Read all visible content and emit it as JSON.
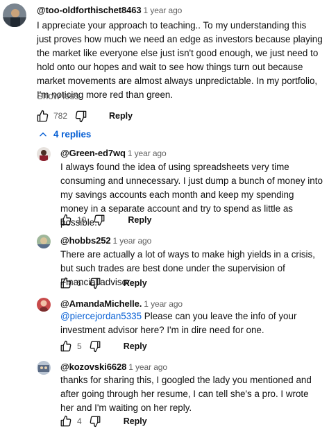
{
  "comments": [
    {
      "author": "@too-oldforthischet8463",
      "time": "1 year ago",
      "text": "I appreciate your approach to teaching.. To my understanding this just proves how much we need an edge as investors because playing the market like everyone else just isn't good enough, we just need to hold onto our hopes and wait to see how things turn out because market movements are almost always unpredictable. In my portfolio, I'm noticing more red than green.",
      "show_less": "Show less",
      "likes": "782",
      "reply_label": "Reply",
      "replies_toggle": "4 replies"
    }
  ],
  "replies": [
    {
      "author": "@Green-ed7wq",
      "time": "1 year ago",
      "text": "I always found the idea of using spreadsheets very time consuming and unnecessary. I just dump a bunch of money into my savings accounts each month and keep my spending money in a separate account and try to spend as little as possible.",
      "likes": "10",
      "reply_label": "Reply"
    },
    {
      "author": "@hobbs252",
      "time": "1 year ago",
      "text": "There are actually a lot of ways to make high yields in a crisis, but such trades are best done under the supervision of Financial advisor.",
      "likes": "5",
      "reply_label": "Reply"
    },
    {
      "author": "@AmandaMichelle.",
      "time": "1 year ago",
      "mention": "@piercejordan5335",
      "text": " Please can you leave the info of your investment advisor here? I'm in dire need for one.",
      "likes": "5",
      "reply_label": "Reply"
    },
    {
      "author": "@kozovski6628",
      "time": "1 year ago",
      "text": "thanks for sharing this, I googled the lady you mentioned and after going through her resume, I can tell she's a pro. I wrote her and I'm waiting on her reply.",
      "likes": "4",
      "reply_label": "Reply"
    }
  ],
  "icons": {
    "like": "thumbs-up-icon",
    "dislike": "thumbs-down-icon",
    "toggle": "chevron-up-icon"
  },
  "colors": {
    "link": "#065fd4",
    "meta": "#606060",
    "text": "#0f0f0f"
  }
}
